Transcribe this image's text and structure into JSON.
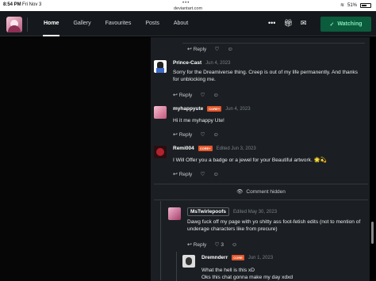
{
  "status_bar": {
    "time": "8:54 PM",
    "date": "Fri Nov 3",
    "url": "deviantart.com",
    "battery": "51%"
  },
  "navbar": {
    "tabs": [
      "Home",
      "Gallery",
      "Favourites",
      "Posts",
      "About"
    ],
    "active_tab": "Home",
    "watch_label": "Watching",
    "icons": [
      "more-icon",
      "gift-icon",
      "mail-icon"
    ]
  },
  "comments": [
    {
      "user": "Prince-Cast",
      "date": "Jun 4, 2023",
      "text": "Sorry for the Dreamiverse thing. Creep is out of my life permanently. And thanks for unblocking me.",
      "badge": ""
    },
    {
      "user": "myhappyute",
      "date": "Jun 4, 2023",
      "text": "Hi it me myhappy Ute!",
      "badge": "CORE+"
    },
    {
      "user": "Remi004",
      "date": "Edited Jun 3, 2023",
      "text": "I Will Offer you a badge or a jewel for your Beautiful artwork. 🌟💫",
      "badge": "CORE+"
    },
    {
      "user": "MsTwirlepoofs",
      "date": "Edited May 30, 2023",
      "text": "Dawg fuck off my page with yo shitty ass foot-fetish edits (not to mention of underage characters like from precure)",
      "badge": ""
    },
    {
      "user": "Dremnderr",
      "date": "Jun 1, 2023",
      "text": "What the hell is this xD",
      "text2": "Oks this chat gonna make my day xdxd",
      "badge": "CORE"
    }
  ],
  "reply_label": "Reply",
  "hidden_label": "Comment hidden",
  "like_count": "3",
  "colors": {
    "accent": "#0b5b3d",
    "watch_text": "#7fe7b4",
    "badge": "#e5562a"
  }
}
